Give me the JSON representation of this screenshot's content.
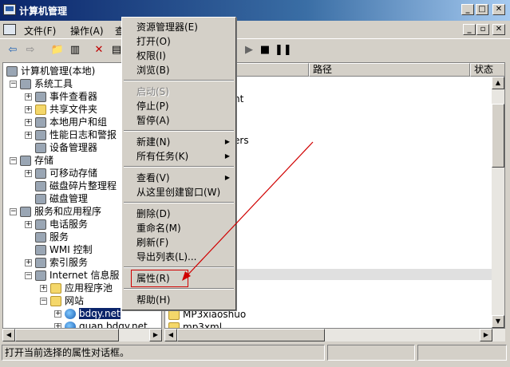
{
  "window": {
    "title": "计算机管理"
  },
  "menubar": {
    "file": "文件(F)",
    "action": "操作(A)",
    "view_partial": "查"
  },
  "toolbar": {
    "icons": [
      "back-icon",
      "forward-icon",
      "up-icon",
      "show-tree-icon",
      "delete-icon",
      "properties-icon",
      "play-icon",
      "stop-icon",
      "pause-icon"
    ]
  },
  "tree": {
    "root": "计算机管理(本地)",
    "system_tools": "系统工具",
    "event_viewer": "事件查看器",
    "shared_folders": "共享文件夹",
    "local_users": "本地用户和组",
    "perf_logs": "性能日志和警报",
    "device_manager": "设备管理器",
    "storage": "存储",
    "removable_storage": "可移动存储",
    "defrag": "磁盘碎片整理程",
    "disk_mgmt": "磁盘管理",
    "services_apps": "服务和应用程序",
    "telephony": "电话服务",
    "services": "服务",
    "wmi": "WMI 控制",
    "indexing": "索引服务",
    "iis": "Internet 信息服",
    "app_pools": "应用程序池",
    "websites": "网站",
    "site1": "bdqy.net",
    "site2": "quan.bdqy.net"
  },
  "list": {
    "col_path": "路径",
    "col_status": "状态",
    "partial_1": "nt",
    "partial_2": "ers",
    "items": [
      "MP3xiaoshuo",
      "mp3xml"
    ]
  },
  "context_menu": {
    "explorer": "资源管理器(E)",
    "open": "打开(O)",
    "permissions": "权限(I)",
    "browse": "浏览(B)",
    "start": "启动(S)",
    "stop": "停止(P)",
    "pause": "暂停(A)",
    "new": "新建(N)",
    "all_tasks": "所有任务(K)",
    "view": "查看(V)",
    "new_window": "从这里创建窗口(W)",
    "delete": "删除(D)",
    "rename": "重命名(M)",
    "refresh": "刷新(F)",
    "export": "导出列表(L)...",
    "properties": "属性(R)",
    "help": "帮助(H)"
  },
  "status": {
    "text": "打开当前选择的属性对话框。"
  },
  "colors": {
    "titlebar": "#0a246a",
    "highlight_box": "#d00000",
    "arrow": "#d00000"
  }
}
